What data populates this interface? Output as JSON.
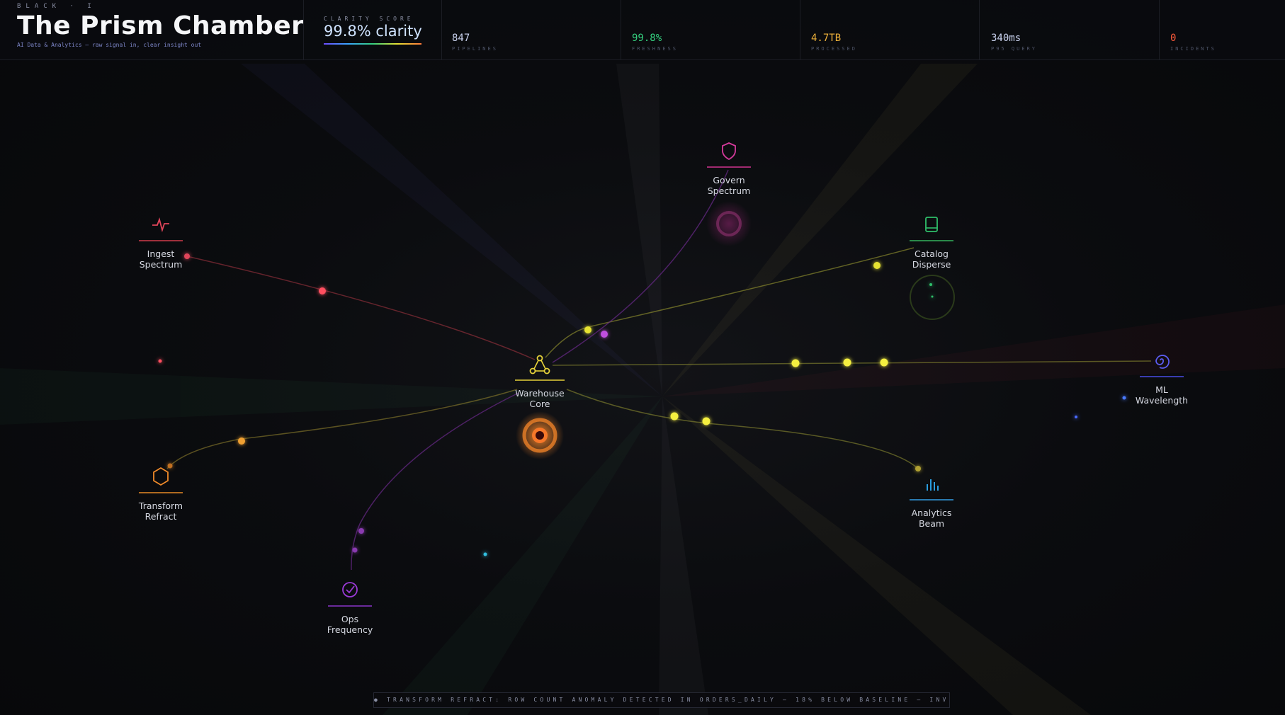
{
  "header": {
    "eyebrow": "BLACK · I",
    "title": "The Prism Chamber",
    "subtitle": "AI Data & Analytics — raw signal in, clear insight out",
    "clarity": {
      "label": "CLARITY SCORE",
      "value": "99.8% clarity"
    },
    "stats": [
      {
        "value": "847",
        "label": "PIPELINES",
        "color": "#c9d2ee"
      },
      {
        "value": "99.8%",
        "label": "FRESHNESS",
        "color": "#35d07f"
      },
      {
        "value": "4.7TB",
        "label": "PROCESSED",
        "color": "#f0b23a"
      },
      {
        "value": "340ms",
        "label": "P95 QUERY",
        "color": "#c9d2ee"
      },
      {
        "value": "0",
        "label": "INCIDENTS",
        "color": "#ff5a3a"
      }
    ]
  },
  "nodes": {
    "ingest": {
      "label1": "Ingest",
      "label2": "Spectrum",
      "icon": "pulse-icon",
      "color": "#e0455a"
    },
    "govern": {
      "label1": "Govern",
      "label2": "Spectrum",
      "icon": "shield-icon",
      "color": "#d63a9c"
    },
    "catalog": {
      "label1": "Catalog",
      "label2": "Disperse",
      "icon": "book-icon",
      "color": "#2fbf6a"
    },
    "warehouse": {
      "label1": "Warehouse",
      "label2": "Core",
      "icon": "triad-icon",
      "color": "#e6d23a"
    },
    "ml": {
      "label1": "ML",
      "label2": "Wavelength",
      "icon": "spiral-icon",
      "color": "#5a5cf0"
    },
    "transform": {
      "label1": "Transform",
      "label2": "Refract",
      "icon": "hexagon-icon",
      "color": "#f08a2a"
    },
    "analytics": {
      "label1": "Analytics",
      "label2": "Beam",
      "icon": "bar-chart-icon",
      "color": "#2a9ee0"
    },
    "ops": {
      "label1": "Ops",
      "label2": "Frequency",
      "icon": "check-circle-icon",
      "color": "#9a3ad6"
    }
  },
  "alert": {
    "text": "● TRANSFORM REFRACT: ROW COUNT ANOMALY DETECTED IN ORDERS_DAILY — 18% BELOW BASELINE — INVESTIGATING"
  }
}
